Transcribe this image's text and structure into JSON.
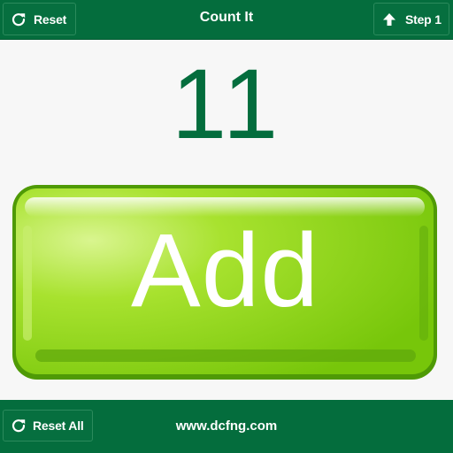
{
  "header": {
    "title": "Count It",
    "reset_label": "Reset",
    "step_label": "Step 1"
  },
  "counter": {
    "value": "11"
  },
  "main": {
    "add_label": "Add"
  },
  "footer": {
    "reset_all_label": "Reset All",
    "site": "www.dcfng.com"
  },
  "colors": {
    "bar": "#046d3d",
    "counter_text": "#046d3d",
    "add_button": "#8fd11e",
    "add_border": "#4f9a06"
  },
  "icons": {
    "reset": "refresh-icon",
    "step": "arrow-up-icon",
    "reset_all": "refresh-icon"
  }
}
